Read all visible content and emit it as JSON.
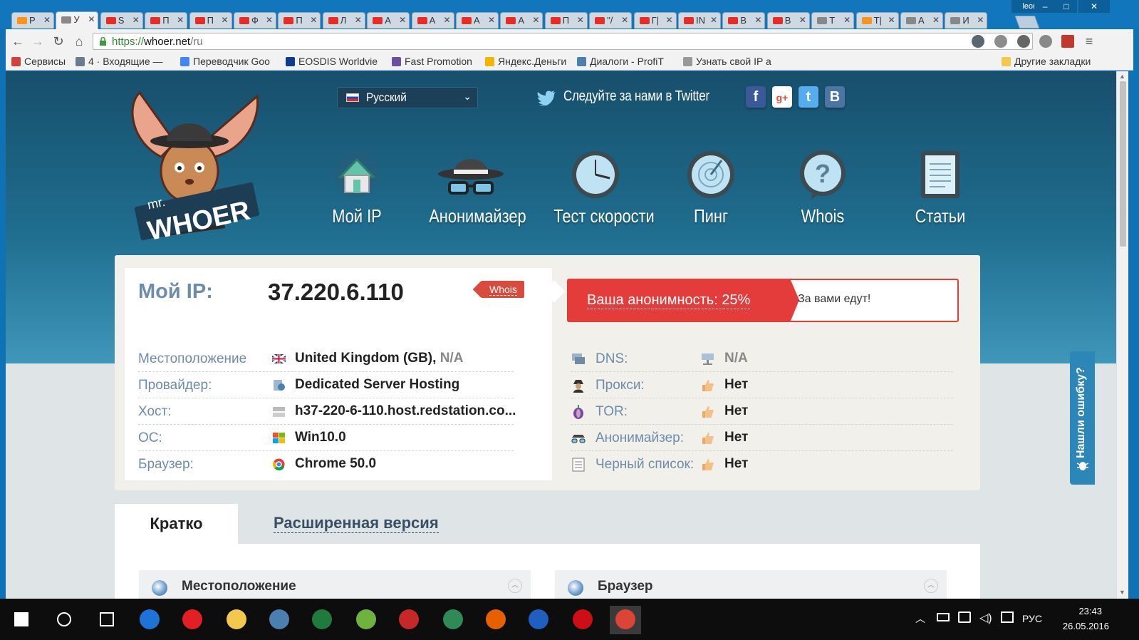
{
  "browser": {
    "tabs": [
      {
        "label": "P",
        "icon": "chart-icon"
      },
      {
        "label": "У",
        "icon": "search-icon",
        "active": true
      },
      {
        "label": "S",
        "icon": "youtube-icon"
      },
      {
        "label": "П",
        "icon": "youtube-icon"
      },
      {
        "label": "П",
        "icon": "youtube-icon"
      },
      {
        "label": "Ф",
        "icon": "youtube-icon"
      },
      {
        "label": "П",
        "icon": "youtube-icon"
      },
      {
        "label": "Л",
        "icon": "youtube-icon"
      },
      {
        "label": "А",
        "icon": "youtube-icon"
      },
      {
        "label": "А",
        "icon": "youtube-icon"
      },
      {
        "label": "А",
        "icon": "youtube-icon"
      },
      {
        "label": "А",
        "icon": "youtube-icon"
      },
      {
        "label": "П",
        "icon": "youtube-icon"
      },
      {
        "label": "\"/",
        "icon": "youtube-icon"
      },
      {
        "label": "Г|",
        "icon": "youtube-icon"
      },
      {
        "label": "IN",
        "icon": "youtube-icon"
      },
      {
        "label": "В",
        "icon": "youtube-icon"
      },
      {
        "label": "В",
        "icon": "youtube-icon"
      },
      {
        "label": "T",
        "icon": "bulb-icon"
      },
      {
        "label": "T|",
        "icon": "ok-icon"
      },
      {
        "label": "А",
        "icon": "cart-icon"
      },
      {
        "label": "И",
        "icon": "history-icon"
      }
    ],
    "profile_name": "leonid",
    "url_scheme": "https://",
    "url_host": "whoer.net",
    "url_path": "/ru",
    "bookmarks": [
      {
        "label": "Сервисы",
        "icon": "apps-icon"
      },
      {
        "label": "4 · Входящие —",
        "icon": "mail-icon"
      },
      {
        "label": "Переводчик Goo",
        "icon": "translate-icon"
      },
      {
        "label": "EOSDIS Worldvie",
        "icon": "nasa-icon"
      },
      {
        "label": "Fast Promotion",
        "icon": "f-icon"
      },
      {
        "label": "Яндекс.Деньги",
        "icon": "yandex-money-icon"
      },
      {
        "label": "Диалоги - ProfiT",
        "icon": "chart-icon"
      },
      {
        "label": "Узнать свой IP а",
        "icon": "search-icon"
      }
    ],
    "other_bookmarks": "Другие закладки"
  },
  "site": {
    "logo_text_top": "mr.",
    "logo_text": "WHOER",
    "language": "Русский",
    "twitter_text": "Следуйте за нами в Twitter",
    "social": [
      "f",
      "g+",
      "t",
      "B"
    ],
    "nav": [
      {
        "label": "Мой IP",
        "icon": "house-icon"
      },
      {
        "label": "Анонимайзер",
        "icon": "spy-hat-glasses-icon"
      },
      {
        "label": "Тест скорости",
        "icon": "speedometer-icon"
      },
      {
        "label": "Пинг",
        "icon": "radar-icon"
      },
      {
        "label": "Whois",
        "icon": "question-bubble-icon"
      },
      {
        "label": "Статьи",
        "icon": "document-icon"
      }
    ]
  },
  "ip_info": {
    "ip_label": "Мой IP:",
    "ip_value": "37.220.6.110",
    "whois_tag": "Whois",
    "rows": [
      {
        "key": "Местоположение",
        "value": "United Kingdom (GB),",
        "extra": "N/A",
        "icon": "uk-flag-icon"
      },
      {
        "key": "Провайдер:",
        "value": "Dedicated Server Hosting",
        "icon": "provider-icon"
      },
      {
        "key": "Хост:",
        "value": "h37-220-6-110.host.redstation.co...",
        "icon": "server-icon"
      },
      {
        "key": "ОС:",
        "value": "Win10.0",
        "icon": "windows-icon"
      },
      {
        "key": "Браузер:",
        "value": "Chrome 50.0",
        "icon": "chrome-icon"
      }
    ]
  },
  "anonymity": {
    "label": "Ваша анонимность: 25%",
    "percent": 25,
    "message": "За вами едут!",
    "rows": [
      {
        "key": "DNS:",
        "value": "N/A",
        "icon": "dns-icon",
        "status_icon": "network-icon"
      },
      {
        "key": "Прокси:",
        "value": "Нет",
        "icon": "spy-icon",
        "status_icon": "thumb-up-icon"
      },
      {
        "key": "TOR:",
        "value": "Нет",
        "icon": "onion-icon",
        "status_icon": "thumb-up-icon"
      },
      {
        "key": "Анонимайзер:",
        "value": "Нет",
        "icon": "glasses-icon",
        "status_icon": "thumb-up-icon"
      },
      {
        "key": "Черный список:",
        "value": "Нет",
        "icon": "list-icon",
        "status_icon": "thumb-up-icon"
      }
    ]
  },
  "tabs": {
    "short": "Кратко",
    "extended": "Расширенная версия"
  },
  "sections": {
    "location": "Местоположение",
    "browser": "Браузер"
  },
  "feedback": "Нашли ошибку?",
  "taskbar": {
    "apps": [
      "windows-start-icon",
      "search-icon",
      "task-view-icon",
      "edge-icon",
      "r-app-icon",
      "explorer-icon",
      "word-doc-icon",
      "excel-icon",
      "utorrent-icon",
      "download-icon",
      "globe-app-icon",
      "firefox-icon",
      "ie-app-icon",
      "opera-icon",
      "chrome-icon"
    ],
    "lang": "РУС",
    "time": "23:43",
    "date": "26.05.2016"
  },
  "colors": {
    "accent_red": "#e43b3b",
    "label_blue": "#6d8caa",
    "hero_blue": "#1f6d8f"
  }
}
